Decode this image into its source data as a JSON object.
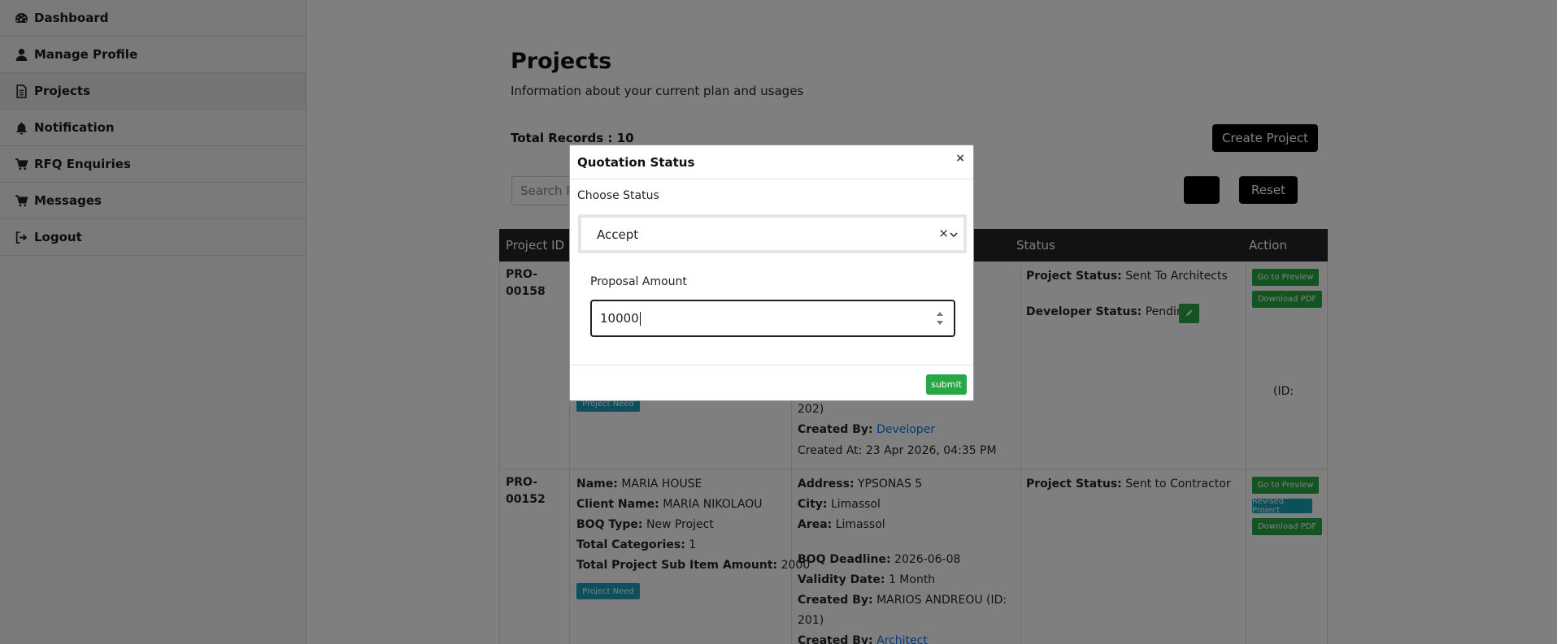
{
  "sidebar": {
    "items": [
      {
        "label": "Dashboard",
        "icon": "dashboard-icon"
      },
      {
        "label": "Manage Profile",
        "icon": "user-icon"
      },
      {
        "label": "Projects",
        "icon": "document-icon",
        "active": true
      },
      {
        "label": "Notification",
        "icon": "bell-icon"
      },
      {
        "label": "RFQ Enquiries",
        "icon": "cart-icon"
      },
      {
        "label": "Messages",
        "icon": "cart-icon"
      },
      {
        "label": "Logout",
        "icon": "logout-icon"
      }
    ]
  },
  "page": {
    "title": "Projects",
    "subtitle": "Information about your current plan and usages",
    "total_records": "Total Records : 10",
    "create_button": "Create Project",
    "search_placeholder": "Search Pr",
    "reset_button": "Reset"
  },
  "table": {
    "headers": [
      "Project ID",
      "Status",
      "Action"
    ],
    "rows": [
      {
        "id_line1": "PRO-",
        "id_line2": "00158",
        "project_need": "Project Need",
        "right_partial": "(ID:",
        "right_id": "202)",
        "created_by_label": "Created By:",
        "created_by": "Developer",
        "created_at": "Created At: 23 Apr 2026, 04:35 PM",
        "project_status_label": "Project Status:",
        "project_status": "Sent To Architects",
        "developer_status_label": "Developer Status:",
        "developer_status": "Pending",
        "actions": [
          "Go to Preview",
          "Download PDF"
        ]
      },
      {
        "id_line1": "PRO-",
        "id_line2": "00152",
        "name_label": "Name:",
        "name": "MARIA HOUSE",
        "client_label": "Client Name:",
        "client": "MARIA NIKOLAOU",
        "boq_type_label": "BOQ Type:",
        "boq_type": "New Project",
        "total_categories_label": "Total Categories:",
        "total_categories": "1",
        "total_sub_label": "Total Project Sub Item Amount:",
        "total_sub": "2000",
        "project_need": "Project Need",
        "address_label": "Address:",
        "address": "YPSONAS 5",
        "city_label": "City:",
        "city": "Limassol",
        "area_label": "Area:",
        "area": "Limassol",
        "boq_deadline_label": "BOQ Deadline:",
        "boq_deadline": "2026-06-08",
        "validity_label": "Validity Date:",
        "validity": "1 Month",
        "created_by_label": "Created By:",
        "created_by_name": "MARIOS ANDREOU (ID:",
        "created_by_id": "201)",
        "created_by_role": "Architect",
        "project_status_label": "Project Status:",
        "project_status": "Sent to Contractor",
        "actions": [
          "Go to Preview",
          "Revised Project",
          "Download PDF"
        ]
      }
    ]
  },
  "modal": {
    "title": "Quotation Status",
    "close": "×",
    "choose_status_label": "Choose Status",
    "status_value": "Accept",
    "clear": "×",
    "proposal_amount_label": "Proposal Amount",
    "proposal_amount_value": "10000",
    "submit_label": "submit"
  },
  "colors": {
    "green": "#28a745",
    "teal": "#17a2b8",
    "dark": "#212529",
    "link": "#0d6efd"
  }
}
